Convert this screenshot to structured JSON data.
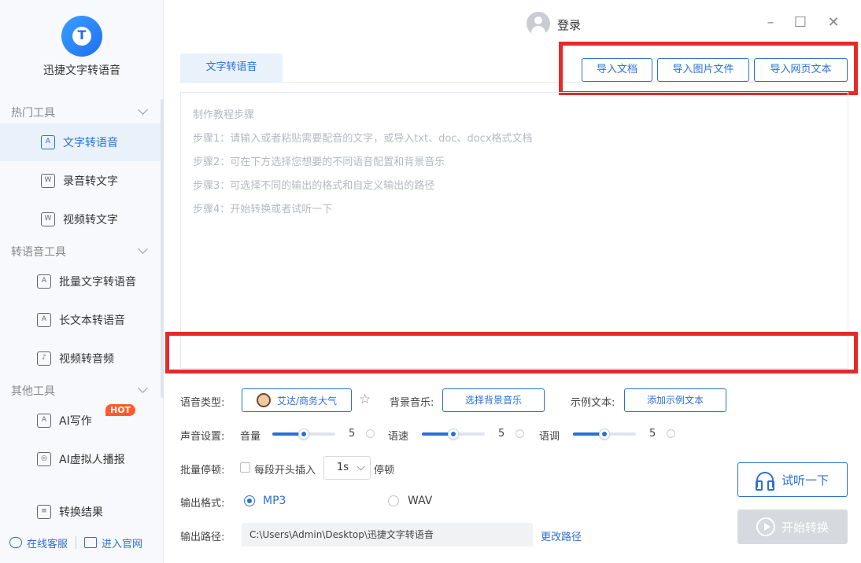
{
  "app": {
    "name": "迅捷文字转语音",
    "logo_text": "T"
  },
  "sidebar": {
    "groups": [
      {
        "title": "热门工具",
        "items": [
          {
            "label": "文字转语音",
            "icon": "text-to-speech-icon",
            "active": true
          },
          {
            "label": "录音转文字",
            "icon": "audio-to-text-icon"
          },
          {
            "label": "视频转文字",
            "icon": "video-to-text-icon"
          }
        ]
      },
      {
        "title": "转语音工具",
        "items": [
          {
            "label": "批量文字转语音",
            "icon": "batch-text-icon"
          },
          {
            "label": "长文本转语音",
            "icon": "long-text-icon"
          },
          {
            "label": "视频转音频",
            "icon": "video-to-audio-icon"
          }
        ]
      },
      {
        "title": "其他工具",
        "items": [
          {
            "label": "AI写作",
            "icon": "ai-write-icon",
            "badge": "HOT"
          },
          {
            "label": "AI虚拟人播报",
            "icon": "ai-avatar-icon"
          }
        ]
      }
    ],
    "result": {
      "label": "转换结果",
      "icon": "result-icon"
    },
    "bottom": {
      "service": "在线客服",
      "website": "进入官网"
    }
  },
  "topbar": {
    "login": "登录",
    "window": {
      "minimize": "–",
      "maximize": "☐",
      "close": "✕"
    }
  },
  "tab": {
    "label": "文字转语音"
  },
  "import": {
    "doc": "导入文档",
    "image": "导入图片文件",
    "web": "导入网页文本"
  },
  "editor": {
    "lines": [
      "制作教程步骤",
      "步骤1：请输入或者粘贴需要配音的文字，或导入txt、doc、docx格式文档",
      "步骤2：可在下方选择您想要的不同语音配置和背景音乐",
      "步骤3：可选择不同的输出的格式和自定义输出的路径",
      "步骤4：开始转换或者试听一下"
    ]
  },
  "settings": {
    "voice_type_label": "语音类型:",
    "voice_name": "艾达/商务大气",
    "bgm_label": "背景音乐:",
    "bgm_button": "选择背景音乐",
    "sample_label": "示例文本:",
    "sample_button": "添加示例文本",
    "sound_label": "声音设置:",
    "volume_label": "音量",
    "volume": "5",
    "volume_fraction": 0.5,
    "speed_label": "语速",
    "speed": "5",
    "speed_fraction": 0.5,
    "pitch_label": "语调",
    "pitch": "5",
    "pitch_fraction": 0.5,
    "pause_label": "批量停顿:",
    "pause_check_label": "每段开头插入",
    "pause_value": "1s",
    "pause_suffix": "停顿",
    "format_label": "输出格式:",
    "format_mp3": "MP3",
    "format_wav": "WAV",
    "format_selected": "MP3",
    "path_label": "输出路径:",
    "path_value": "C:\\Users\\Admin\\Desktop\\迅捷文字转语音",
    "change_path": "更改路径"
  },
  "actions": {
    "listen": "试听一下",
    "start": "开始转换"
  },
  "colors": {
    "accent": "#2b6fd6",
    "highlight_border": "#e62a2a",
    "hot_badge": "#ff5a2b",
    "disabled": "#d6d9de"
  }
}
